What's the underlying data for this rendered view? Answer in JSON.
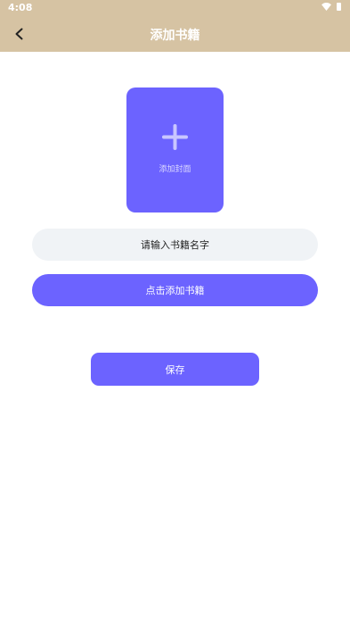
{
  "status_bar": {
    "time": "4:08",
    "icons": [
      "wifi-icon",
      "battery-icon"
    ]
  },
  "app_bar": {
    "title": "添加书籍",
    "back_icon": "chevron-left-icon",
    "background": "#d6c3a3"
  },
  "cover": {
    "icon": "plus-icon",
    "label": "添加封面",
    "color": "#6c63ff"
  },
  "form": {
    "name_placeholder": "请输入书籍名字",
    "name_value": "",
    "add_book_label": "点击添加书籍",
    "save_label": "保存"
  },
  "colors": {
    "accent": "#6c63ff",
    "input_background": "#f0f3f6",
    "header": "#d6c3a3"
  }
}
